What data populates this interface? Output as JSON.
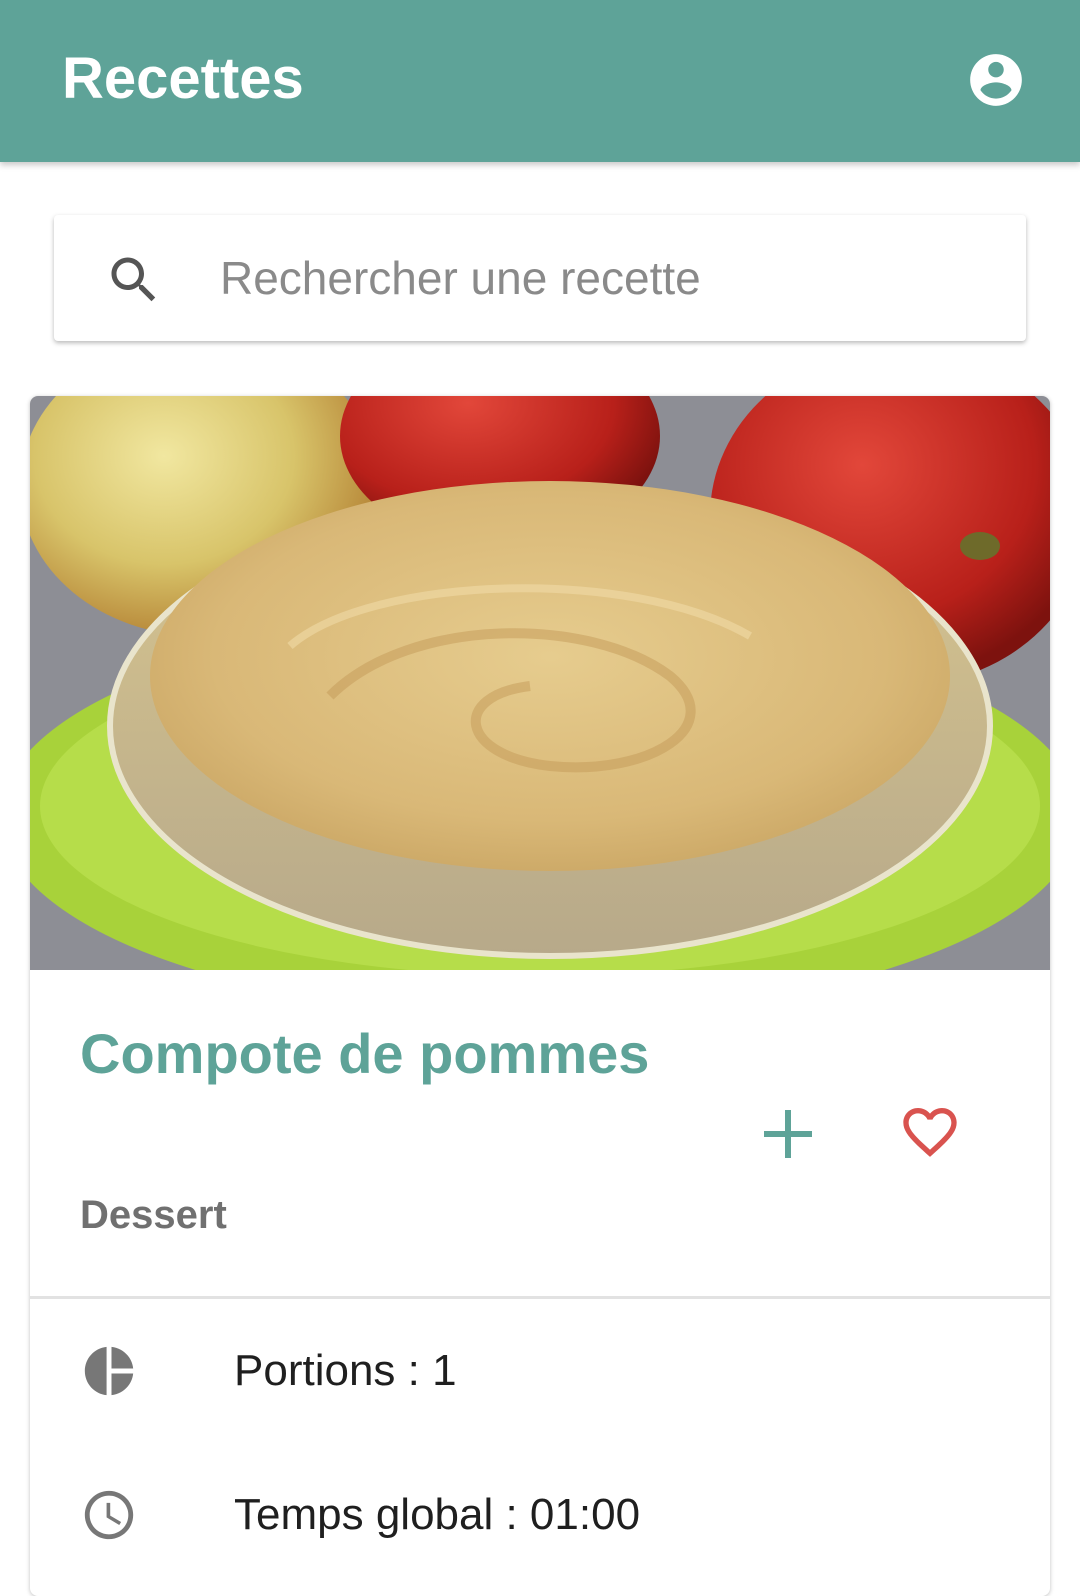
{
  "app_bar": {
    "title": "Recettes",
    "account_icon": "account-circle-icon",
    "color": "#5ea398"
  },
  "search": {
    "placeholder": "Rechercher une recette",
    "value": "",
    "icon": "search-icon"
  },
  "recipe": {
    "title": "Compote de pommes",
    "category": "Dessert",
    "add_icon": "plus-icon",
    "favorite_icon": "heart-outline-icon",
    "title_color": "#5ea398",
    "favorite_color": "#d9534f",
    "info": [
      {
        "icon": "pie-chart-icon",
        "text": "Portions : 1"
      },
      {
        "icon": "clock-icon",
        "text": "Temps global : 01:00"
      }
    ]
  }
}
